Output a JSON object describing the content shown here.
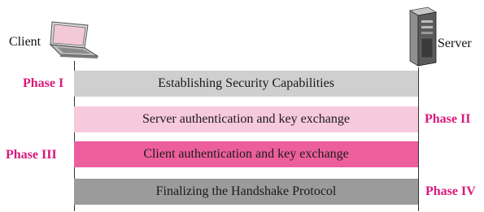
{
  "parties": {
    "client": {
      "label": "Client",
      "icon": "laptop-icon"
    },
    "server": {
      "label": "Server",
      "icon": "server-tower-icon"
    }
  },
  "phases": [
    {
      "label": "Phase I",
      "text": "Establishing Security Capabilities",
      "band_color": "#cfcfcf",
      "side": "left"
    },
    {
      "label": "Phase II",
      "text": "Server authentication and key exchange",
      "band_color": "#f7c9dc",
      "side": "right"
    },
    {
      "label": "Phase III",
      "text": "Client authentication and key exchange",
      "band_color": "#ec5f9c",
      "side": "left"
    },
    {
      "label": "Phase IV",
      "text": "Finalizing the Handshake Protocol",
      "band_color": "#9b9b9b",
      "side": "right"
    }
  ],
  "colors": {
    "phase_label": "#d8197b",
    "lifeline": "#333333"
  }
}
